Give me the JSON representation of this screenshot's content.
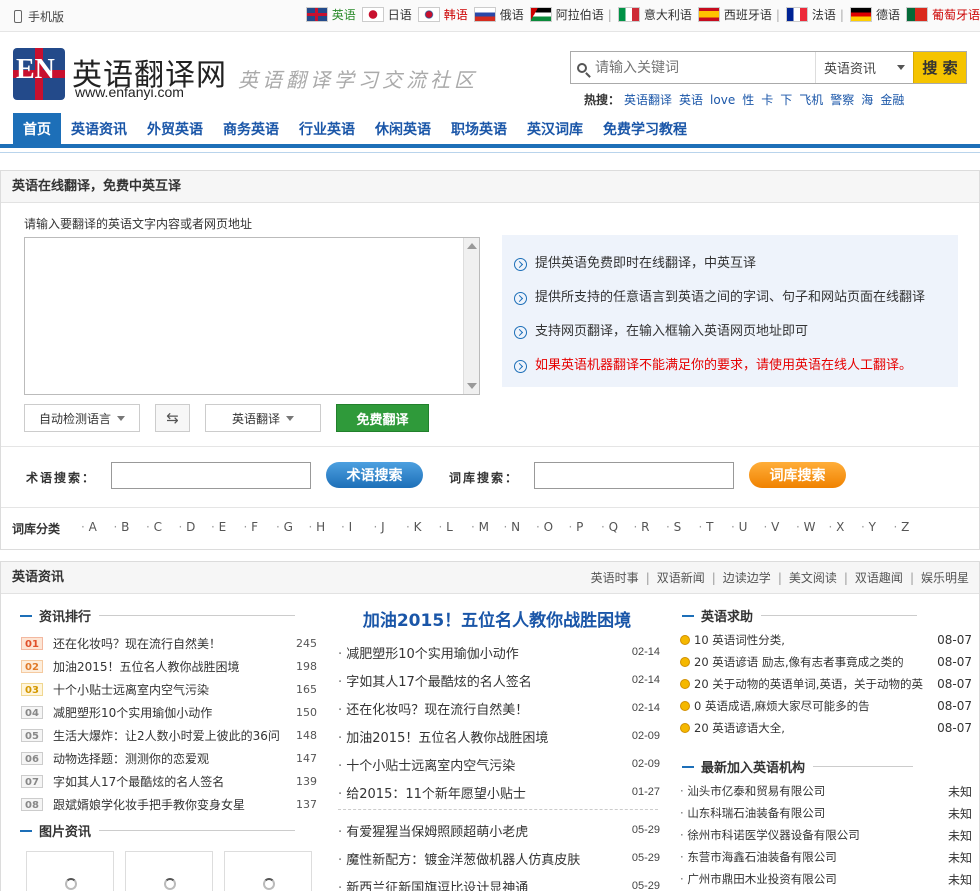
{
  "topbar": {
    "mobile": "手机版",
    "languages": [
      {
        "name": "英语",
        "flag": "uk-flag-icon",
        "color": "green"
      },
      {
        "name": "日语",
        "flag": "japan-flag-icon",
        "color": ""
      },
      {
        "name": "韩语",
        "flag": "korea-flag-icon",
        "color": "red"
      },
      {
        "name": "俄语",
        "flag": "russia-flag-icon",
        "color": ""
      },
      {
        "name": "阿拉伯语",
        "flag": "palestine-flag-icon",
        "color": ""
      },
      {
        "name": "意大利语",
        "flag": "italy-flag-icon",
        "color": ""
      },
      {
        "name": "西班牙语",
        "flag": "spain-flag-icon",
        "color": ""
      },
      {
        "name": "法语",
        "flag": "france-flag-icon",
        "color": ""
      },
      {
        "name": "德语",
        "flag": "germany-flag-icon",
        "color": ""
      },
      {
        "name": "葡萄牙语",
        "flag": "portugal-flag-icon",
        "color": "red"
      }
    ]
  },
  "header": {
    "logo_text": "EN",
    "site_name": "英语翻译网",
    "site_url": "www.enfanyi.com",
    "slogan": "英语翻译学习交流社区"
  },
  "search": {
    "placeholder": "请输入关键词",
    "category": "英语资讯",
    "button": "搜 索",
    "hot_label": "热搜：",
    "hot_words": [
      "英语翻译",
      "英语",
      "love",
      "性",
      "卡",
      "下",
      "飞机",
      "警察",
      "海",
      "金融"
    ]
  },
  "nav": {
    "items": [
      "首页",
      "英语资讯",
      "外贸英语",
      "商务英语",
      "行业英语",
      "休闲英语",
      "职场英语",
      "英汉词库",
      "免费学习教程"
    ]
  },
  "translate": {
    "title": "英语在线翻译，免费中英互译",
    "prompt": "请输入要翻译的英语文字内容或者网页地址",
    "source_lang": "自动检测语言",
    "target_lang": "英语翻译",
    "button": "免费翻译",
    "tips": [
      "提供英语免费即时在线翻译，中英互译",
      "提供所支持的任意语言到英语之间的字词、句子和网站页面在线翻译",
      "支持网页翻译，在输入框输入英语网页地址即可",
      "如果英语机器翻译不能满足你的要求，请使用英语在线人工翻译。"
    ],
    "term_label": "术语搜索：",
    "term_button": "术语搜索",
    "dict_label": "词库搜索：",
    "dict_button": "词库搜索",
    "category_label": "词库分类",
    "letters": [
      "A",
      "B",
      "C",
      "D",
      "E",
      "F",
      "G",
      "H",
      "I",
      "J",
      "K",
      "L",
      "M",
      "N",
      "O",
      "P",
      "Q",
      "R",
      "S",
      "T",
      "U",
      "V",
      "W",
      "X",
      "Y",
      "Z"
    ]
  },
  "news": {
    "title": "英语资讯",
    "subnav": [
      "英语时事",
      "双语新闻",
      "边读边学",
      "美文阅读",
      "双语趣闻",
      "娱乐明星"
    ],
    "ranking_title": "资讯排行",
    "ranking": [
      {
        "num": "01",
        "title": "还在化妆吗？现在流行自然美！",
        "count": "245"
      },
      {
        "num": "02",
        "title": "加油2015！五位名人教你战胜困境",
        "count": "198"
      },
      {
        "num": "03",
        "title": "十个小贴士远离室内空气污染",
        "count": "165"
      },
      {
        "num": "04",
        "title": "减肥塑形10个实用瑜伽小动作",
        "count": "150"
      },
      {
        "num": "05",
        "title": "生活大爆炸：让2人数小时爱上彼此的36问",
        "count": "148"
      },
      {
        "num": "06",
        "title": "动物选择题：测测你的恋爱观",
        "count": "147"
      },
      {
        "num": "07",
        "title": "字如其人17个最酷炫的名人签名",
        "count": "139"
      },
      {
        "num": "08",
        "title": "跟斌婿娘学化妆手把手教你变身女星",
        "count": "137"
      }
    ],
    "pics_title": "图片资讯",
    "headline": "加油2015！五位名人教你战胜困境",
    "list_a": [
      {
        "title": "减肥塑形10个实用瑜伽小动作",
        "date": "02-14"
      },
      {
        "title": "字如其人17个最酷炫的名人签名",
        "date": "02-14"
      },
      {
        "title": "还在化妆吗？现在流行自然美！",
        "date": "02-14"
      },
      {
        "title": "加油2015！五位名人教你战胜困境",
        "date": "02-09"
      },
      {
        "title": "十个小贴士远离室内空气污染",
        "date": "02-09"
      },
      {
        "title": "给2015：11个新年愿望小贴士",
        "date": "01-27"
      }
    ],
    "list_b": [
      {
        "title": "有爱猩猩当保姆照顾超萌小老虎",
        "date": "05-29"
      },
      {
        "title": "魔性新配方：镀金洋葱做机器人仿真皮肤",
        "date": "05-29"
      },
      {
        "title": "新西兰征新国旗逗比设计显神通",
        "date": "05-29"
      }
    ],
    "qa_title": "英语求助",
    "qa": [
      {
        "score": "10",
        "title": "英语词性分类,",
        "date": "08-07"
      },
      {
        "score": "20",
        "title": "英语谚语 励志,像有志者事竟成之类的",
        "date": "08-07"
      },
      {
        "score": "20",
        "title": "关于动物的英语单词,英语，关于动物的英",
        "date": "08-07"
      },
      {
        "score": "0",
        "title": "英语成语,麻烦大家尽可能多的告",
        "date": "08-07"
      },
      {
        "score": "20",
        "title": "英语谚语大全,",
        "date": "08-07"
      }
    ],
    "org_title": "最新加入英语机构",
    "orgs": [
      {
        "name": "汕头市亿泰和贸易有限公司",
        "status": "未知"
      },
      {
        "name": "山东科瑞石油装备有限公司",
        "status": "未知"
      },
      {
        "name": "徐州市科诺医学仪器设备有限公司",
        "status": "未知"
      },
      {
        "name": "东营市海鑫石油装备有限公司",
        "status": "未知"
      },
      {
        "name": "广州市鼎田木业投资有限公司",
        "status": "未知"
      }
    ]
  }
}
